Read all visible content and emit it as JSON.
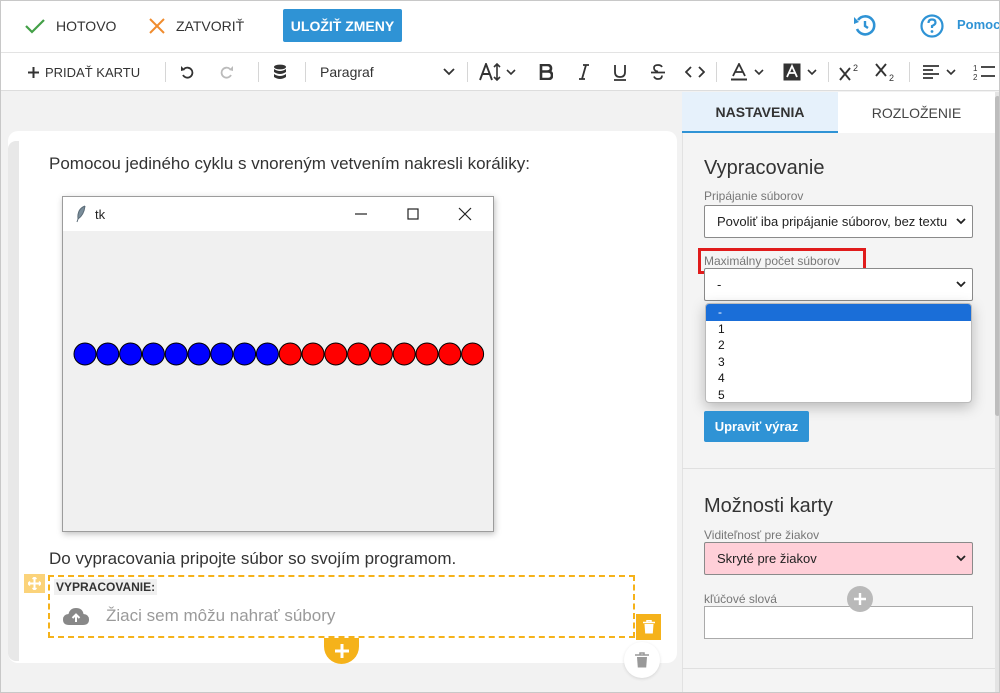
{
  "topbar": {
    "done_label": "HOTOVO",
    "close_label": "ZATVORIŤ",
    "save_label": "ULOŽIŤ ZMENY",
    "help_label": "Pomoc"
  },
  "toolbar": {
    "add_card_label": "PRIDAŤ KARTU",
    "format_value": "Paragraf"
  },
  "editor": {
    "intro_text": "Pomocou jediného cyklu s vnoreným vetvením nakresli koráliky:",
    "window_title": "tk",
    "beads": {
      "blue_count": 9,
      "red_count": 9
    },
    "task_text": "Do vypracovania pripojte súbor so svojím programom.",
    "upload_label": "VYPRACOVANIE:",
    "upload_hint": "Žiaci sem môžu nahrať súbory"
  },
  "panel": {
    "tabs": [
      {
        "label": "NASTAVENIA",
        "active": true
      },
      {
        "label": "ROZLOŽENIE",
        "active": false
      }
    ],
    "submission": {
      "title": "Vypracovanie",
      "attach_label": "Pripájanie súborov",
      "attach_value": "Povoliť iba pripájanie súborov, bez textu",
      "max_files_label": "Maximálny počet súborov",
      "max_files_value": "-",
      "max_files_options": [
        "-",
        "1",
        "2",
        "3",
        "4",
        "5"
      ],
      "edit_expression_label": "Upraviť výraz"
    },
    "card_options": {
      "title": "Možnosti karty",
      "visibility_label": "Viditeľnosť pre žiakov",
      "visibility_value": "Skryté pre žiakov",
      "keywords_label": "kľúčové slová"
    }
  },
  "colors": {
    "accent": "#2f93d5",
    "highlight_box": "#e01b1b",
    "block_border": "#f5b21a",
    "visibility_bg": "#ffcfd8",
    "bead_blue": "#0000ff",
    "bead_red": "#ff0000"
  }
}
